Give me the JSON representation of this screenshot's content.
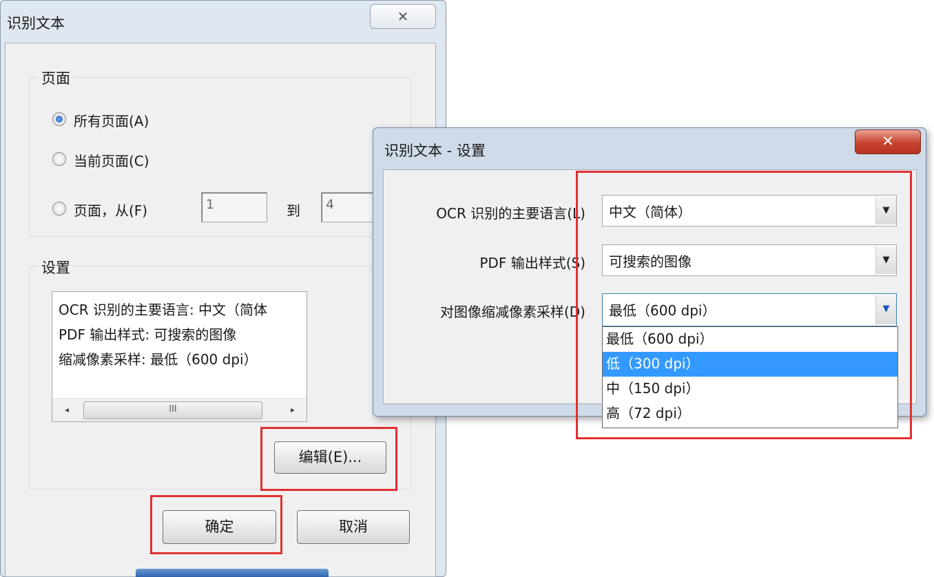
{
  "main_dialog": {
    "title": "识别文本",
    "close_glyph": "✕",
    "pages_group": {
      "label": "页面",
      "all_pages": "所有页面(A)",
      "current_page": "当前页面(C)",
      "page_range": "页面，从(F)",
      "from_value": "1",
      "to_label": "到",
      "to_value": "4",
      "selected": "all_pages"
    },
    "settings_group": {
      "label": "设置",
      "lines": [
        "OCR 识别的主要语言: 中文（简体",
        "PDF 输出样式: 可搜索的图像",
        "缩减像素采样: 最低（600 dpi）"
      ],
      "scroll_thumb_glyph": "III",
      "left_arrow": "◂",
      "right_arrow": "▸"
    },
    "edit_button": "编辑(E)...",
    "ok_button": "确定",
    "cancel_button": "取消"
  },
  "settings_dialog": {
    "title": "识别文本 - 设置",
    "close_glyph": "✕",
    "language_label": "OCR 识别的主要语言(L)",
    "language_value": "中文（简体）",
    "output_label": "PDF 输出样式(S)",
    "output_value": "可搜索的图像",
    "downsample_label": "对图像缩减像素采样(D)",
    "downsample_value": "最低（600 dpi）",
    "arrow_glyph": "▼",
    "downsample_options": [
      "最低（600 dpi）",
      "低（300 dpi）",
      "中（150 dpi）",
      "高（72 dpi）"
    ],
    "highlighted_option": 1
  },
  "colors": {
    "highlight_red": "#e03030",
    "selection_blue": "#3399ff"
  }
}
